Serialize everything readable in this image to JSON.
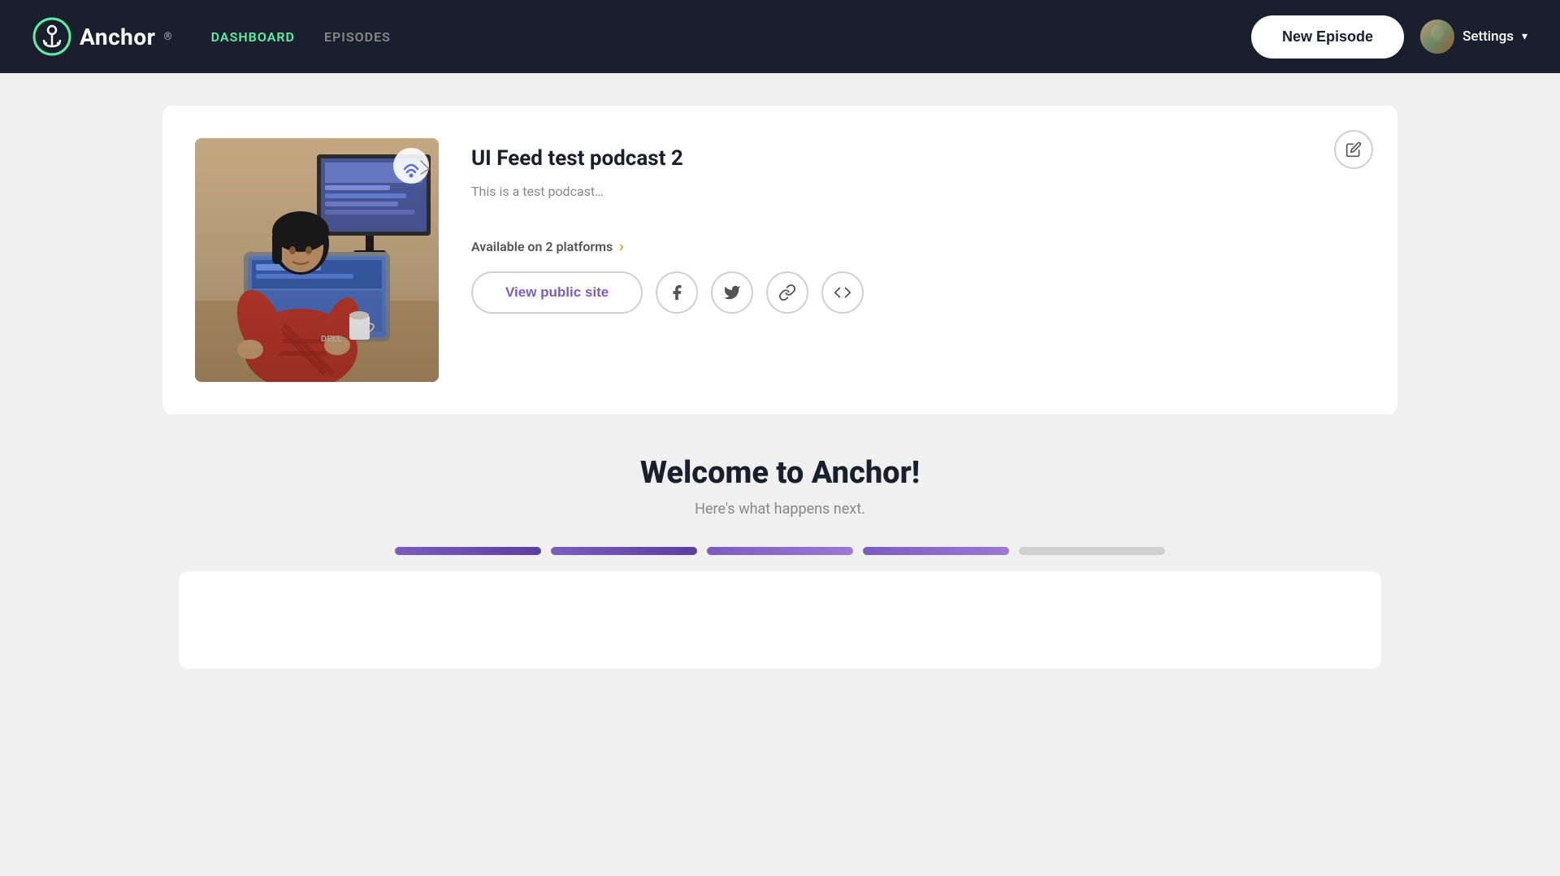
{
  "navbar": {
    "logo_text": "Anchor",
    "logo_registered": "®",
    "nav_links": [
      {
        "id": "dashboard",
        "label": "DASHBOARD",
        "active": true
      },
      {
        "id": "episodes",
        "label": "EPISODES",
        "active": false
      }
    ],
    "new_episode_label": "New Episode",
    "settings_label": "Settings",
    "settings_chevron": "▾"
  },
  "podcast_card": {
    "title": "UI Feed test podcast 2",
    "description": "This is a test podcast…",
    "platforms_text": "Available on 2 platforms",
    "platforms_arrow": "›",
    "view_site_label": "View public site",
    "edit_icon": "✎",
    "social_buttons": [
      {
        "id": "facebook",
        "icon": "f",
        "label": "Facebook"
      },
      {
        "id": "twitter",
        "icon": "🐦",
        "label": "Twitter"
      },
      {
        "id": "link",
        "icon": "🔗",
        "label": "Copy link"
      },
      {
        "id": "embed",
        "icon": "</>",
        "label": "Embed"
      }
    ]
  },
  "welcome_section": {
    "title": "Welcome to Anchor!",
    "subtitle": "Here's what happens next.",
    "progress_steps": [
      {
        "id": 1,
        "state": "done"
      },
      {
        "id": 2,
        "state": "done"
      },
      {
        "id": 3,
        "state": "active"
      },
      {
        "id": 4,
        "state": "active"
      },
      {
        "id": 5,
        "state": "inactive"
      }
    ]
  }
}
